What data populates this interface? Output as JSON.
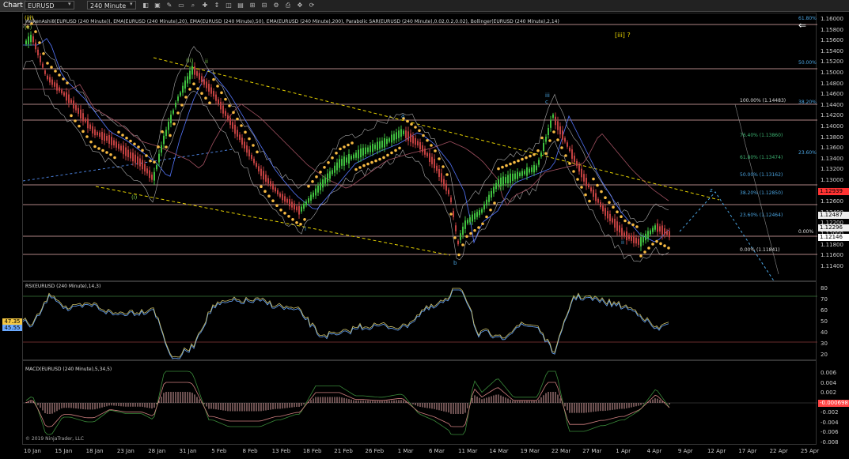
{
  "toolbar": {
    "tab": "Chart",
    "instrument": "EURUSD",
    "interval": "240 Minute",
    "tools": [
      "◧",
      "▣",
      "✎",
      "▭",
      "⌕",
      "✚",
      "↕",
      "◫",
      "▤",
      "⊞",
      "⊟",
      "⚙",
      "⎙",
      "✥",
      "⟳"
    ]
  },
  "price_panel": {
    "indicator_title": "HeikenAshi8(EURUSD (240 Minute)), EMA(EURUSD (240 Minute),20), EMA(EURUSD (240 Minute),50), EMA(EURUSD (240 Minute),200), Parabolic SAR(EURUSD (240 Minute),0.02,0.2,0.02), Bollinger(EURUSD (240 Minute),2,14)",
    "annotation": "[iii] ?",
    "y_ticks": [
      "1.16000",
      "1.15800",
      "1.15600",
      "1.15400",
      "1.15200",
      "1.15000",
      "1.14800",
      "1.14600",
      "1.14400",
      "1.14200",
      "1.14000",
      "1.13800",
      "1.13600",
      "1.13400",
      "1.13200",
      "1.13000",
      "1.12800",
      "1.12600",
      "1.12400",
      "1.12200",
      "1.12000",
      "1.11800",
      "1.11600",
      "1.11400"
    ],
    "price_labels": [
      {
        "text": "1.12939",
        "color": "#ff3333"
      },
      {
        "text": "1.12487",
        "color": "#eeeeee"
      },
      {
        "text": "1.12296",
        "color": "#eeeeee"
      },
      {
        "text": "1.12146",
        "color": "#ffffff"
      }
    ],
    "fib_right": [
      "61.80%",
      "50.00%",
      "38.20%",
      "23.60%",
      "0.00%"
    ],
    "fib_levels": [
      {
        "text": "100.00% (1.14483)",
        "color": "#dddddd"
      },
      {
        "text": "76.40% (1.13860)",
        "color": "#3cb371"
      },
      {
        "text": "61.80% (1.13474)",
        "color": "#3cb371"
      },
      {
        "text": "50.00% (1.13162)",
        "color": "#4aa3df"
      },
      {
        "text": "38.20% (1.12850)",
        "color": "#4aa3df"
      },
      {
        "text": "23.60% (1.12464)",
        "color": "#4aa3df"
      },
      {
        "text": "0.00% (1.11841)",
        "color": "#dddddd"
      }
    ],
    "wave_labels": [
      "(iii)",
      "(c)",
      "(ii)",
      "(i)",
      "iii",
      "c",
      "a",
      "b",
      "z",
      "ii",
      "i",
      "ii"
    ]
  },
  "rsi_panel": {
    "title": "RSI(EURUSD (240 Minute),14,3)",
    "y_ticks": [
      "80",
      "70",
      "60",
      "50",
      "40",
      "30",
      "20"
    ],
    "value_labels": [
      "47.35",
      "45.55"
    ]
  },
  "macd_panel": {
    "title": "MACD(EURUSD (240 Minute),5,34,5)",
    "y_ticks": [
      "0.006",
      "0.004",
      "0.002",
      "0",
      "-0.002",
      "-0.004",
      "-0.006",
      "-0.008"
    ],
    "value_label": "-0.000698",
    "copyright": "© 2019 NinjaTrader, LLC"
  },
  "x_axis": [
    "10 Jan",
    "15 Jan",
    "18 Jan",
    "23 Jan",
    "28 Jan",
    "31 Jan",
    "5 Feb",
    "8 Feb",
    "13 Feb",
    "18 Feb",
    "21 Feb",
    "26 Feb",
    "1 Mar",
    "6 Mar",
    "11 Mar",
    "14 Mar",
    "19 Mar",
    "22 Mar",
    "27 Mar",
    "1 Apr",
    "4 Apr",
    "9 Apr",
    "12 Apr",
    "17 Apr",
    "22 Apr",
    "25 Apr"
  ],
  "colors": {
    "up": "#3fbf3f",
    "down": "#c04040",
    "sar": "#f5b942",
    "trend": "#e6d200",
    "hline": "#e8b0b0",
    "rsi": "#6aa9ff",
    "macd": "#d08080"
  }
}
